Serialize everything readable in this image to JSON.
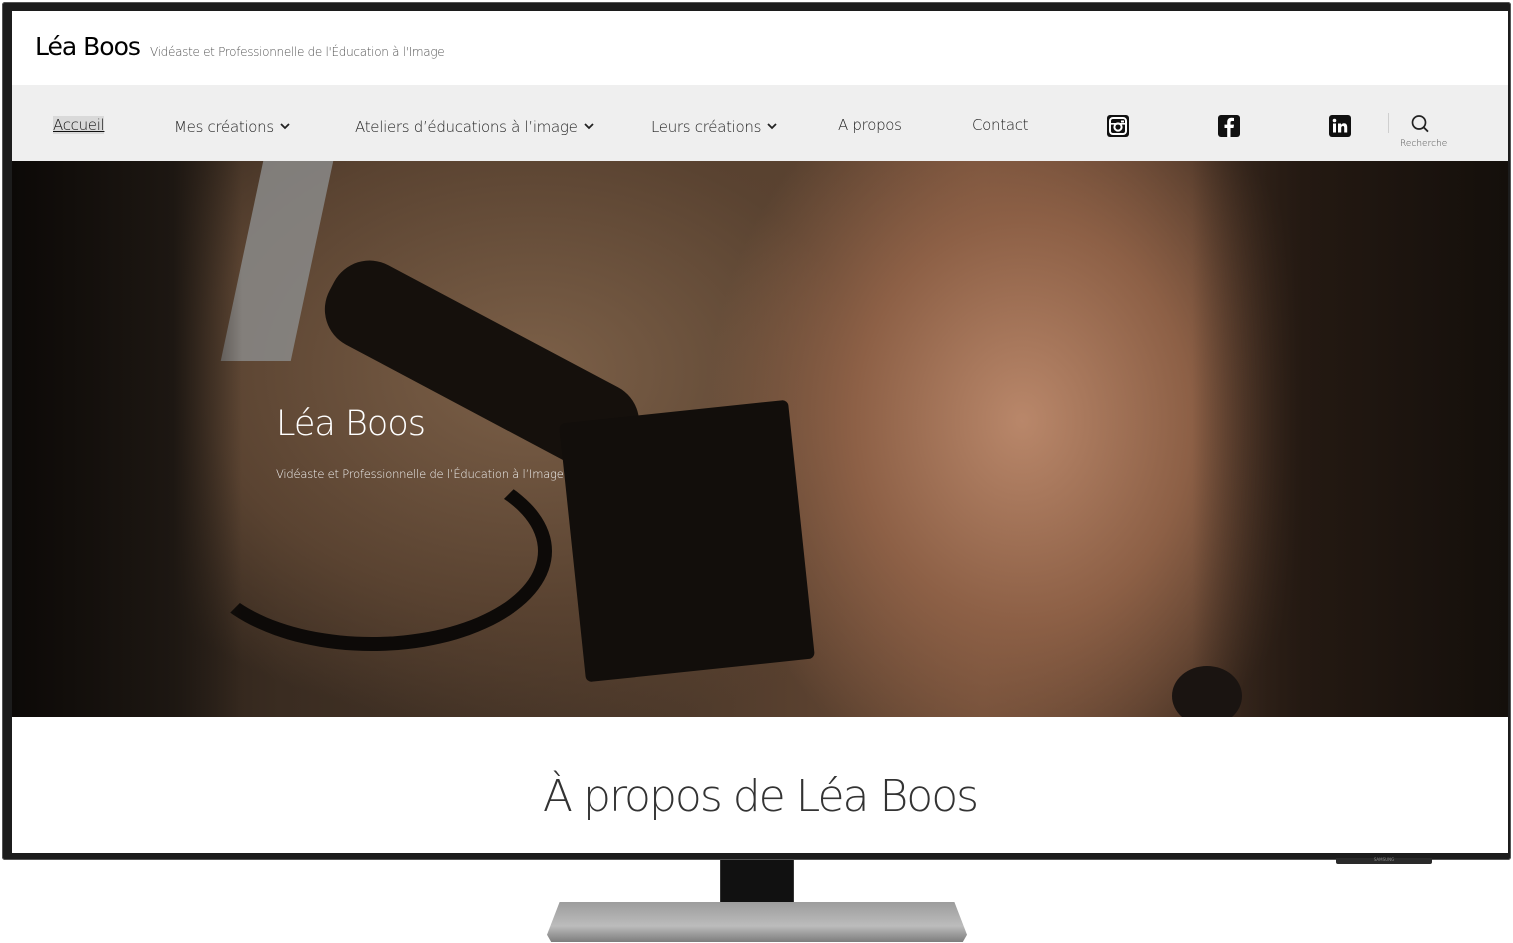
{
  "site": {
    "title": "Léa Boos",
    "tagline": "Vidéaste et Professionnelle de l'Éducation à l'Image"
  },
  "nav": {
    "items": [
      {
        "label": "Accueil",
        "active": true
      },
      {
        "label": "Mes créations",
        "dropdown": true
      },
      {
        "label": "Ateliers d’éducations à l’image",
        "dropdown": true
      },
      {
        "label": "Leurs créations",
        "dropdown": true
      },
      {
        "label": "A propos"
      },
      {
        "label": "Contact"
      }
    ],
    "social": [
      "instagram-icon",
      "facebook-icon",
      "linkedin-icon"
    ],
    "search_label": "Recherche"
  },
  "hero": {
    "title": "Léa Boos",
    "subtitle": "Vidéaste et Professionnelle de l’Éducation à l’Image"
  },
  "section": {
    "title": "À propos de Léa Boos"
  },
  "device": {
    "brand": "SAMSUNG"
  },
  "colors": {
    "nav_bg": "#efefef",
    "text": "#222222",
    "bezel": "#1c1c1c"
  }
}
